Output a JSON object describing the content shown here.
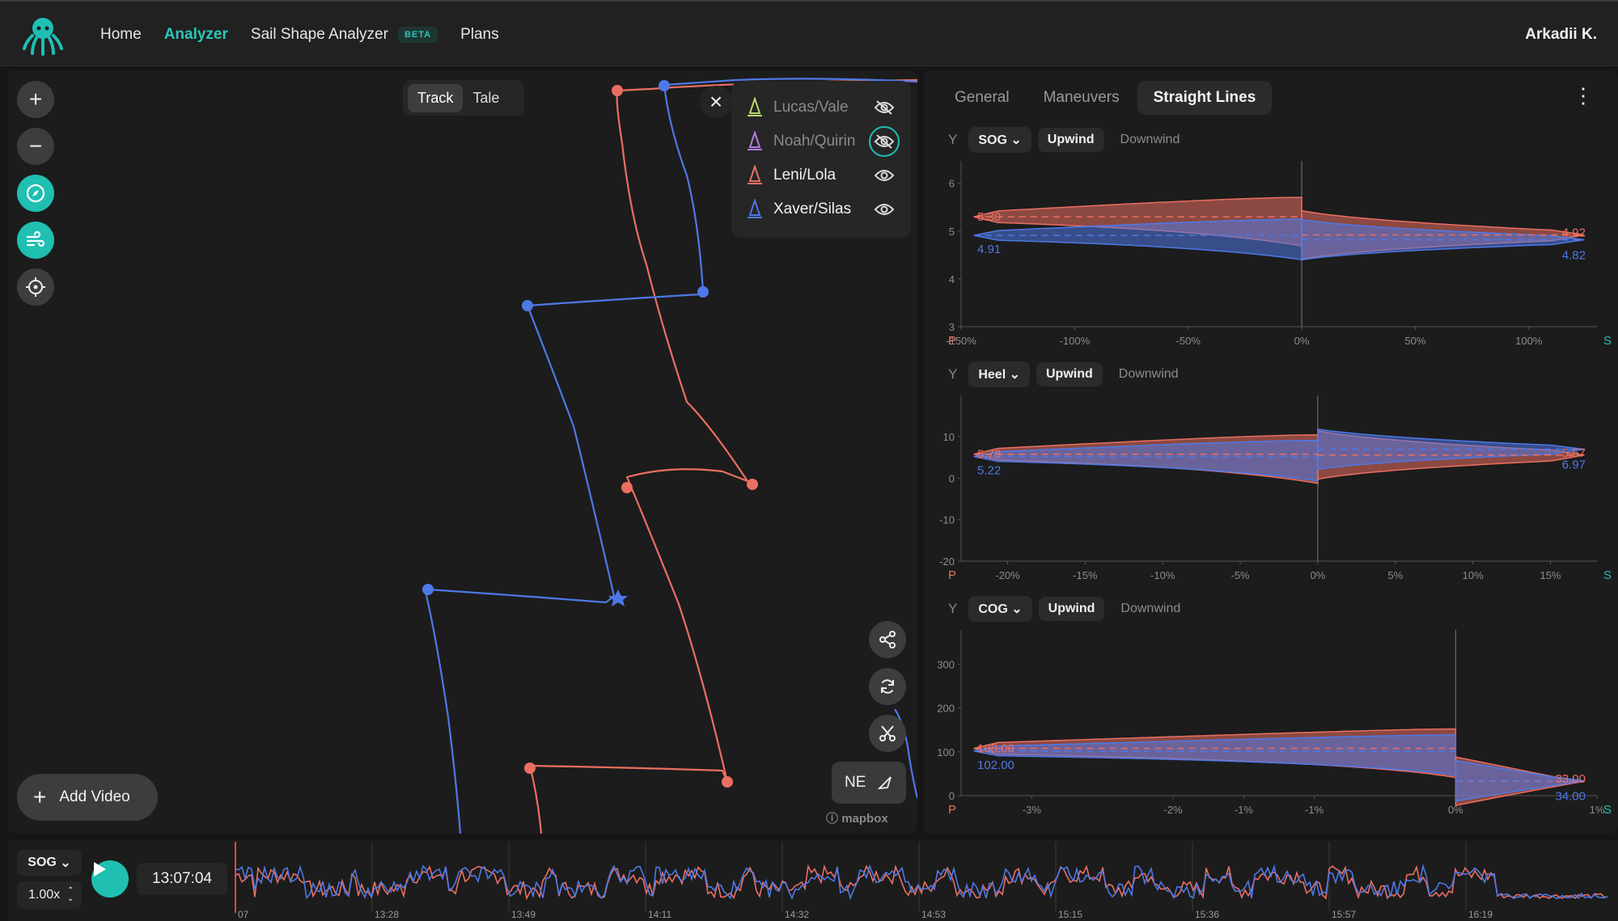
{
  "nav": {
    "items": [
      {
        "label": "Home"
      },
      {
        "label": "Analyzer"
      },
      {
        "label": "Sail Shape Analyzer"
      },
      {
        "label": "Plans"
      }
    ],
    "beta_badge": "BETA",
    "user_name": "Arkadii K."
  },
  "map": {
    "view_toggle": [
      "Track",
      "Tale"
    ],
    "active_view": "Track",
    "boats": [
      {
        "name": "Lucas/Vale",
        "color": "#b7d86a",
        "visible": false
      },
      {
        "name": "Noah/Quirin",
        "color": "#b07ce0",
        "visible": false
      },
      {
        "name": "Leni/Lola",
        "color": "#ea6f62",
        "visible": true
      },
      {
        "name": "Xaver/Silas",
        "color": "#4e78e6",
        "visible": true
      }
    ],
    "wind_direction": "NE",
    "attribution": "mapbox",
    "add_video_label": "Add Video"
  },
  "panel": {
    "tabs": [
      {
        "label": "General"
      },
      {
        "label": "Maneuvers"
      },
      {
        "label": "Straight Lines"
      }
    ],
    "active_tab": "Straight Lines",
    "y_label": "Y",
    "p_label": "P",
    "s_label": "S",
    "upwind_label": "Upwind",
    "downwind_label": "Downwind"
  },
  "chart_data": [
    {
      "type": "area",
      "metric": "SOG",
      "mode": "Upwind",
      "y_ticks": [
        "6",
        "5",
        "4",
        "3"
      ],
      "ylim": [
        3,
        6.3
      ],
      "x_ticks": [
        "-150%",
        "-100%",
        "-50%",
        "0%",
        "50%",
        "100%"
      ],
      "xlim": [
        -150,
        130
      ],
      "series": [
        {
          "name": "Leni/Lola",
          "port_mean": "5.30",
          "starboard_mean": "4.92"
        },
        {
          "name": "Xaver/Silas",
          "port_mean": "4.91",
          "starboard_mean": "4.82"
        }
      ]
    },
    {
      "type": "area",
      "metric": "Heel",
      "mode": "Upwind",
      "y_ticks": [
        "10",
        "0",
        "-10",
        "-20"
      ],
      "ylim": [
        -20,
        18
      ],
      "x_ticks": [
        "-20%",
        "-15%",
        "-10%",
        "-5%",
        "0%",
        "5%",
        "10%",
        "15%"
      ],
      "xlim": [
        -23,
        18
      ],
      "series": [
        {
          "name": "Leni/Lola",
          "port_mean": "5.78",
          "starboard_mean": "5.57"
        },
        {
          "name": "Xaver/Silas",
          "port_mean": "5.22",
          "starboard_mean": "6.97"
        }
      ]
    },
    {
      "type": "area",
      "metric": "COG",
      "mode": "Upwind",
      "y_ticks": [
        "300",
        "200",
        "100",
        "0"
      ],
      "ylim": [
        0,
        360
      ],
      "x_ticks": [
        "-3%",
        "-2%",
        "-1%",
        "-1%",
        "0%",
        "1%"
      ],
      "xlim": [
        -3.5,
        1
      ],
      "series": [
        {
          "name": "Leni/Lola",
          "port_mean": "108.00",
          "starboard_mean": "33.00"
        },
        {
          "name": "Xaver/Silas",
          "port_mean": "102.00",
          "starboard_mean": "34.00"
        }
      ]
    }
  ],
  "timeline": {
    "metric": "SOG",
    "speed": "1.00x",
    "current_time": "13:07:04",
    "ticks": [
      "07",
      "13:28",
      "13:49",
      "14:11",
      "14:32",
      "14:53",
      "15:15",
      "15:36",
      "15:57",
      "16:19"
    ]
  },
  "colors": {
    "accent": "#1fbfb2",
    "red": "#ea6f62",
    "blue": "#4e78e6"
  }
}
